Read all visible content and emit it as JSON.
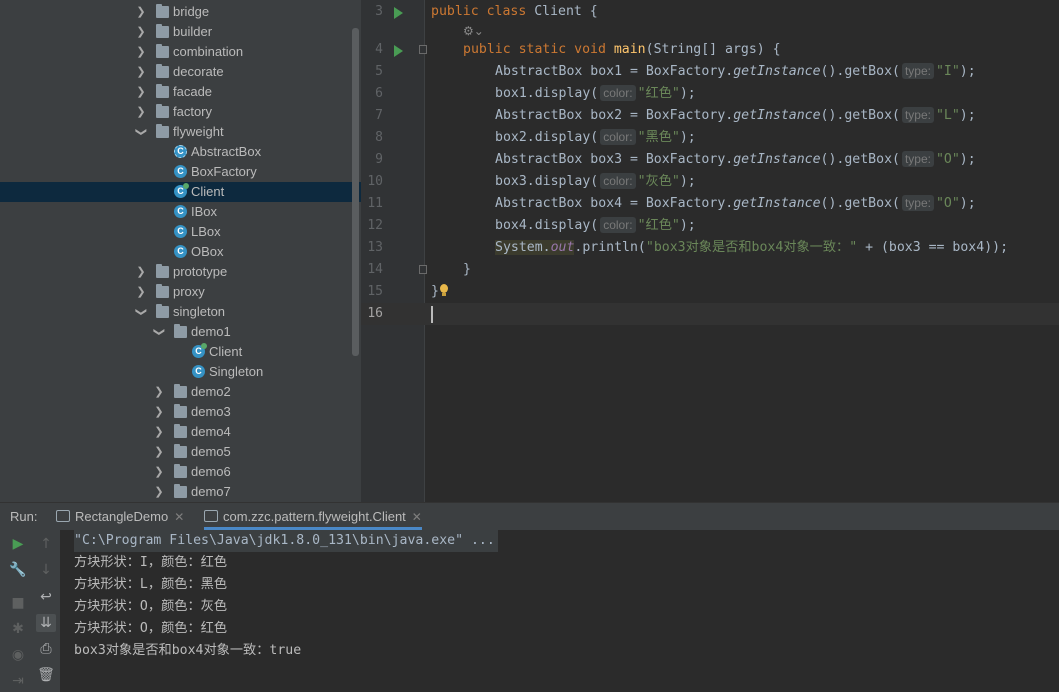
{
  "tree": {
    "items": [
      {
        "label": "bridge",
        "type": "folder",
        "expanded": false
      },
      {
        "label": "builder",
        "type": "folder",
        "expanded": false
      },
      {
        "label": "combination",
        "type": "folder",
        "expanded": false
      },
      {
        "label": "decorate",
        "type": "folder",
        "expanded": false
      },
      {
        "label": "facade",
        "type": "folder",
        "expanded": false
      },
      {
        "label": "factory",
        "type": "folder",
        "expanded": false
      },
      {
        "label": "flyweight",
        "type": "folder",
        "expanded": true
      },
      {
        "label": "AbstractBox",
        "type": "class-abstract"
      },
      {
        "label": "BoxFactory",
        "type": "class"
      },
      {
        "label": "Client",
        "type": "class-runnable",
        "selected": true
      },
      {
        "label": "IBox",
        "type": "class"
      },
      {
        "label": "LBox",
        "type": "class"
      },
      {
        "label": "OBox",
        "type": "class"
      },
      {
        "label": "prototype",
        "type": "folder",
        "expanded": false
      },
      {
        "label": "proxy",
        "type": "folder",
        "expanded": false
      },
      {
        "label": "singleton",
        "type": "folder",
        "expanded": true
      },
      {
        "label": "demo1",
        "type": "folder",
        "expanded": true
      },
      {
        "label": "Client",
        "type": "class-runnable"
      },
      {
        "label": "Singleton",
        "type": "class"
      },
      {
        "label": "demo2",
        "type": "folder",
        "expanded": false
      },
      {
        "label": "demo3",
        "type": "folder",
        "expanded": false
      },
      {
        "label": "demo4",
        "type": "folder",
        "expanded": false
      },
      {
        "label": "demo5",
        "type": "folder",
        "expanded": false
      },
      {
        "label": "demo6",
        "type": "folder",
        "expanded": false
      },
      {
        "label": "demo7",
        "type": "folder",
        "expanded": false
      }
    ]
  },
  "editor": {
    "lines": [
      "3",
      "4",
      "5",
      "6",
      "7",
      "8",
      "9",
      "10",
      "11",
      "12",
      "13",
      "14",
      "15",
      "16"
    ],
    "code": {
      "l3_kw": "public class ",
      "l3_rest": "Client {",
      "l4_kw": "public static void ",
      "l4_fn": "main",
      "l4_rest": "(String[] args) {",
      "ab": "AbstractBox ",
      "bf": "BoxFactory.",
      "gi": "getInstance",
      "gb": "().getBox(",
      "type_hint": "type:",
      "color_hint": "color:",
      "box1": "box1 = ",
      "box2": "box2 = ",
      "box3": "box3 = ",
      "box4": "box4 = ",
      "sI": "\"I\"",
      "sL": "\"L\"",
      "sO": "\"O\"",
      "end": ");",
      "d1": "box1.display(",
      "d2": "box2.display(",
      "d3": "box3.display(",
      "d4": "box4.display(",
      "red": "\"红色\"",
      "black": "\"黑色\"",
      "gray": "\"灰色\"",
      "sys": "System.",
      "out": "out",
      "println": ".println(",
      "msg": "\"box3对象是否和box4对象一致：\"",
      "cmp": " + (box3 == box4));",
      "close_method": "}",
      "close_class": "}"
    }
  },
  "run": {
    "label": "Run:",
    "tabs": [
      {
        "label": "RectangleDemo"
      },
      {
        "label": "com.zzc.pattern.flyweight.Client"
      }
    ],
    "console": [
      "\"C:\\Program Files\\Java\\jdk1.8.0_131\\bin\\java.exe\" ...",
      "方块形状：I，颜色：红色",
      "方块形状：L，颜色：黑色",
      "方块形状：O，颜色：灰色",
      "方块形状：O，颜色：红色",
      "box3对象是否和box4对象一致：true"
    ]
  },
  "colors": {
    "keyword": "#cc7832",
    "function": "#ffc66d",
    "string": "#6a8759",
    "field": "#9876aa",
    "run": "#499c54",
    "selection": "#0d293e"
  }
}
